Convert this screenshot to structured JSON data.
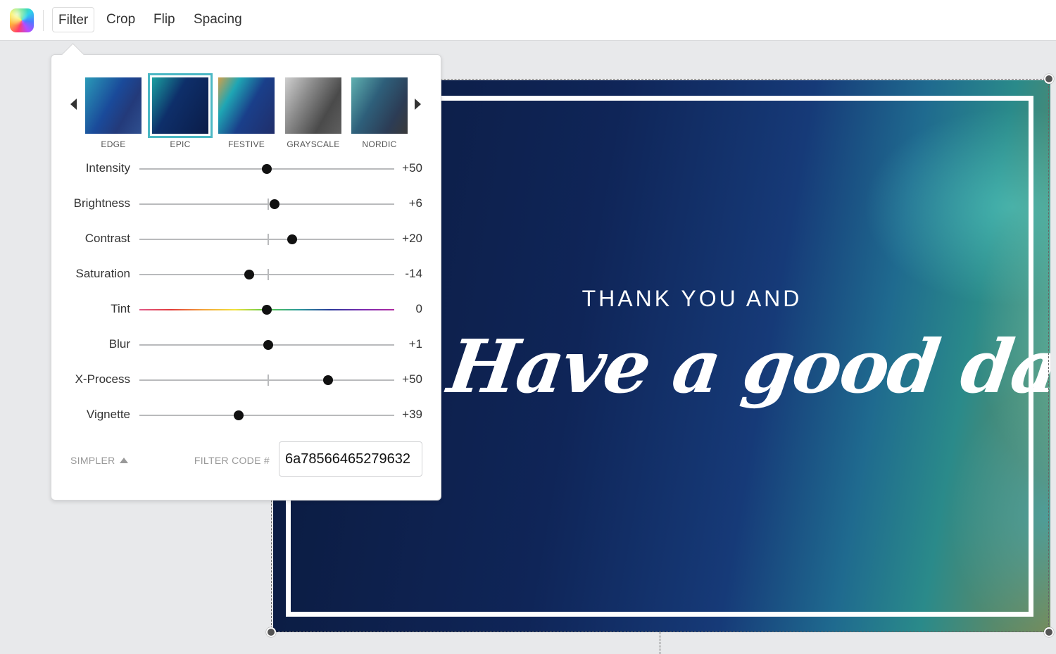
{
  "toolbar": {
    "tabs": [
      "Filter",
      "Crop",
      "Flip",
      "Spacing"
    ],
    "active_tab": "Filter"
  },
  "filters": {
    "presets": [
      {
        "label": "EDGE",
        "selected": false
      },
      {
        "label": "EPIC",
        "selected": true
      },
      {
        "label": "FESTIVE",
        "selected": false
      },
      {
        "label": "GRAYSCALE",
        "selected": false
      },
      {
        "label": "NORDIC",
        "selected": false
      }
    ],
    "adjustments": [
      {
        "label": "Intensity",
        "value": "+50",
        "position": 0.5,
        "center_tick": false
      },
      {
        "label": "Brightness",
        "value": "+6",
        "position": 0.53,
        "center_tick": true
      },
      {
        "label": "Contrast",
        "value": "+20",
        "position": 0.6,
        "center_tick": true
      },
      {
        "label": "Saturation",
        "value": "-14",
        "position": 0.43,
        "center_tick": true
      },
      {
        "label": "Tint",
        "value": "0",
        "position": 0.5,
        "center_tick": false
      },
      {
        "label": "Blur",
        "value": "+1",
        "position": 0.505,
        "center_tick": false
      },
      {
        "label": "X-Process",
        "value": "+50",
        "position": 0.74,
        "center_tick": true
      },
      {
        "label": "Vignette",
        "value": "+39",
        "position": 0.39,
        "center_tick": false
      }
    ],
    "simpler_label": "SIMPLER",
    "filter_code_label": "FILTER CODE #",
    "filter_code": "6a78566465279632"
  },
  "card": {
    "line1": "THANK YOU AND",
    "line2": "Have a good day"
  },
  "colors": {
    "accent": "#4bb8c4",
    "knob": "#111111"
  }
}
